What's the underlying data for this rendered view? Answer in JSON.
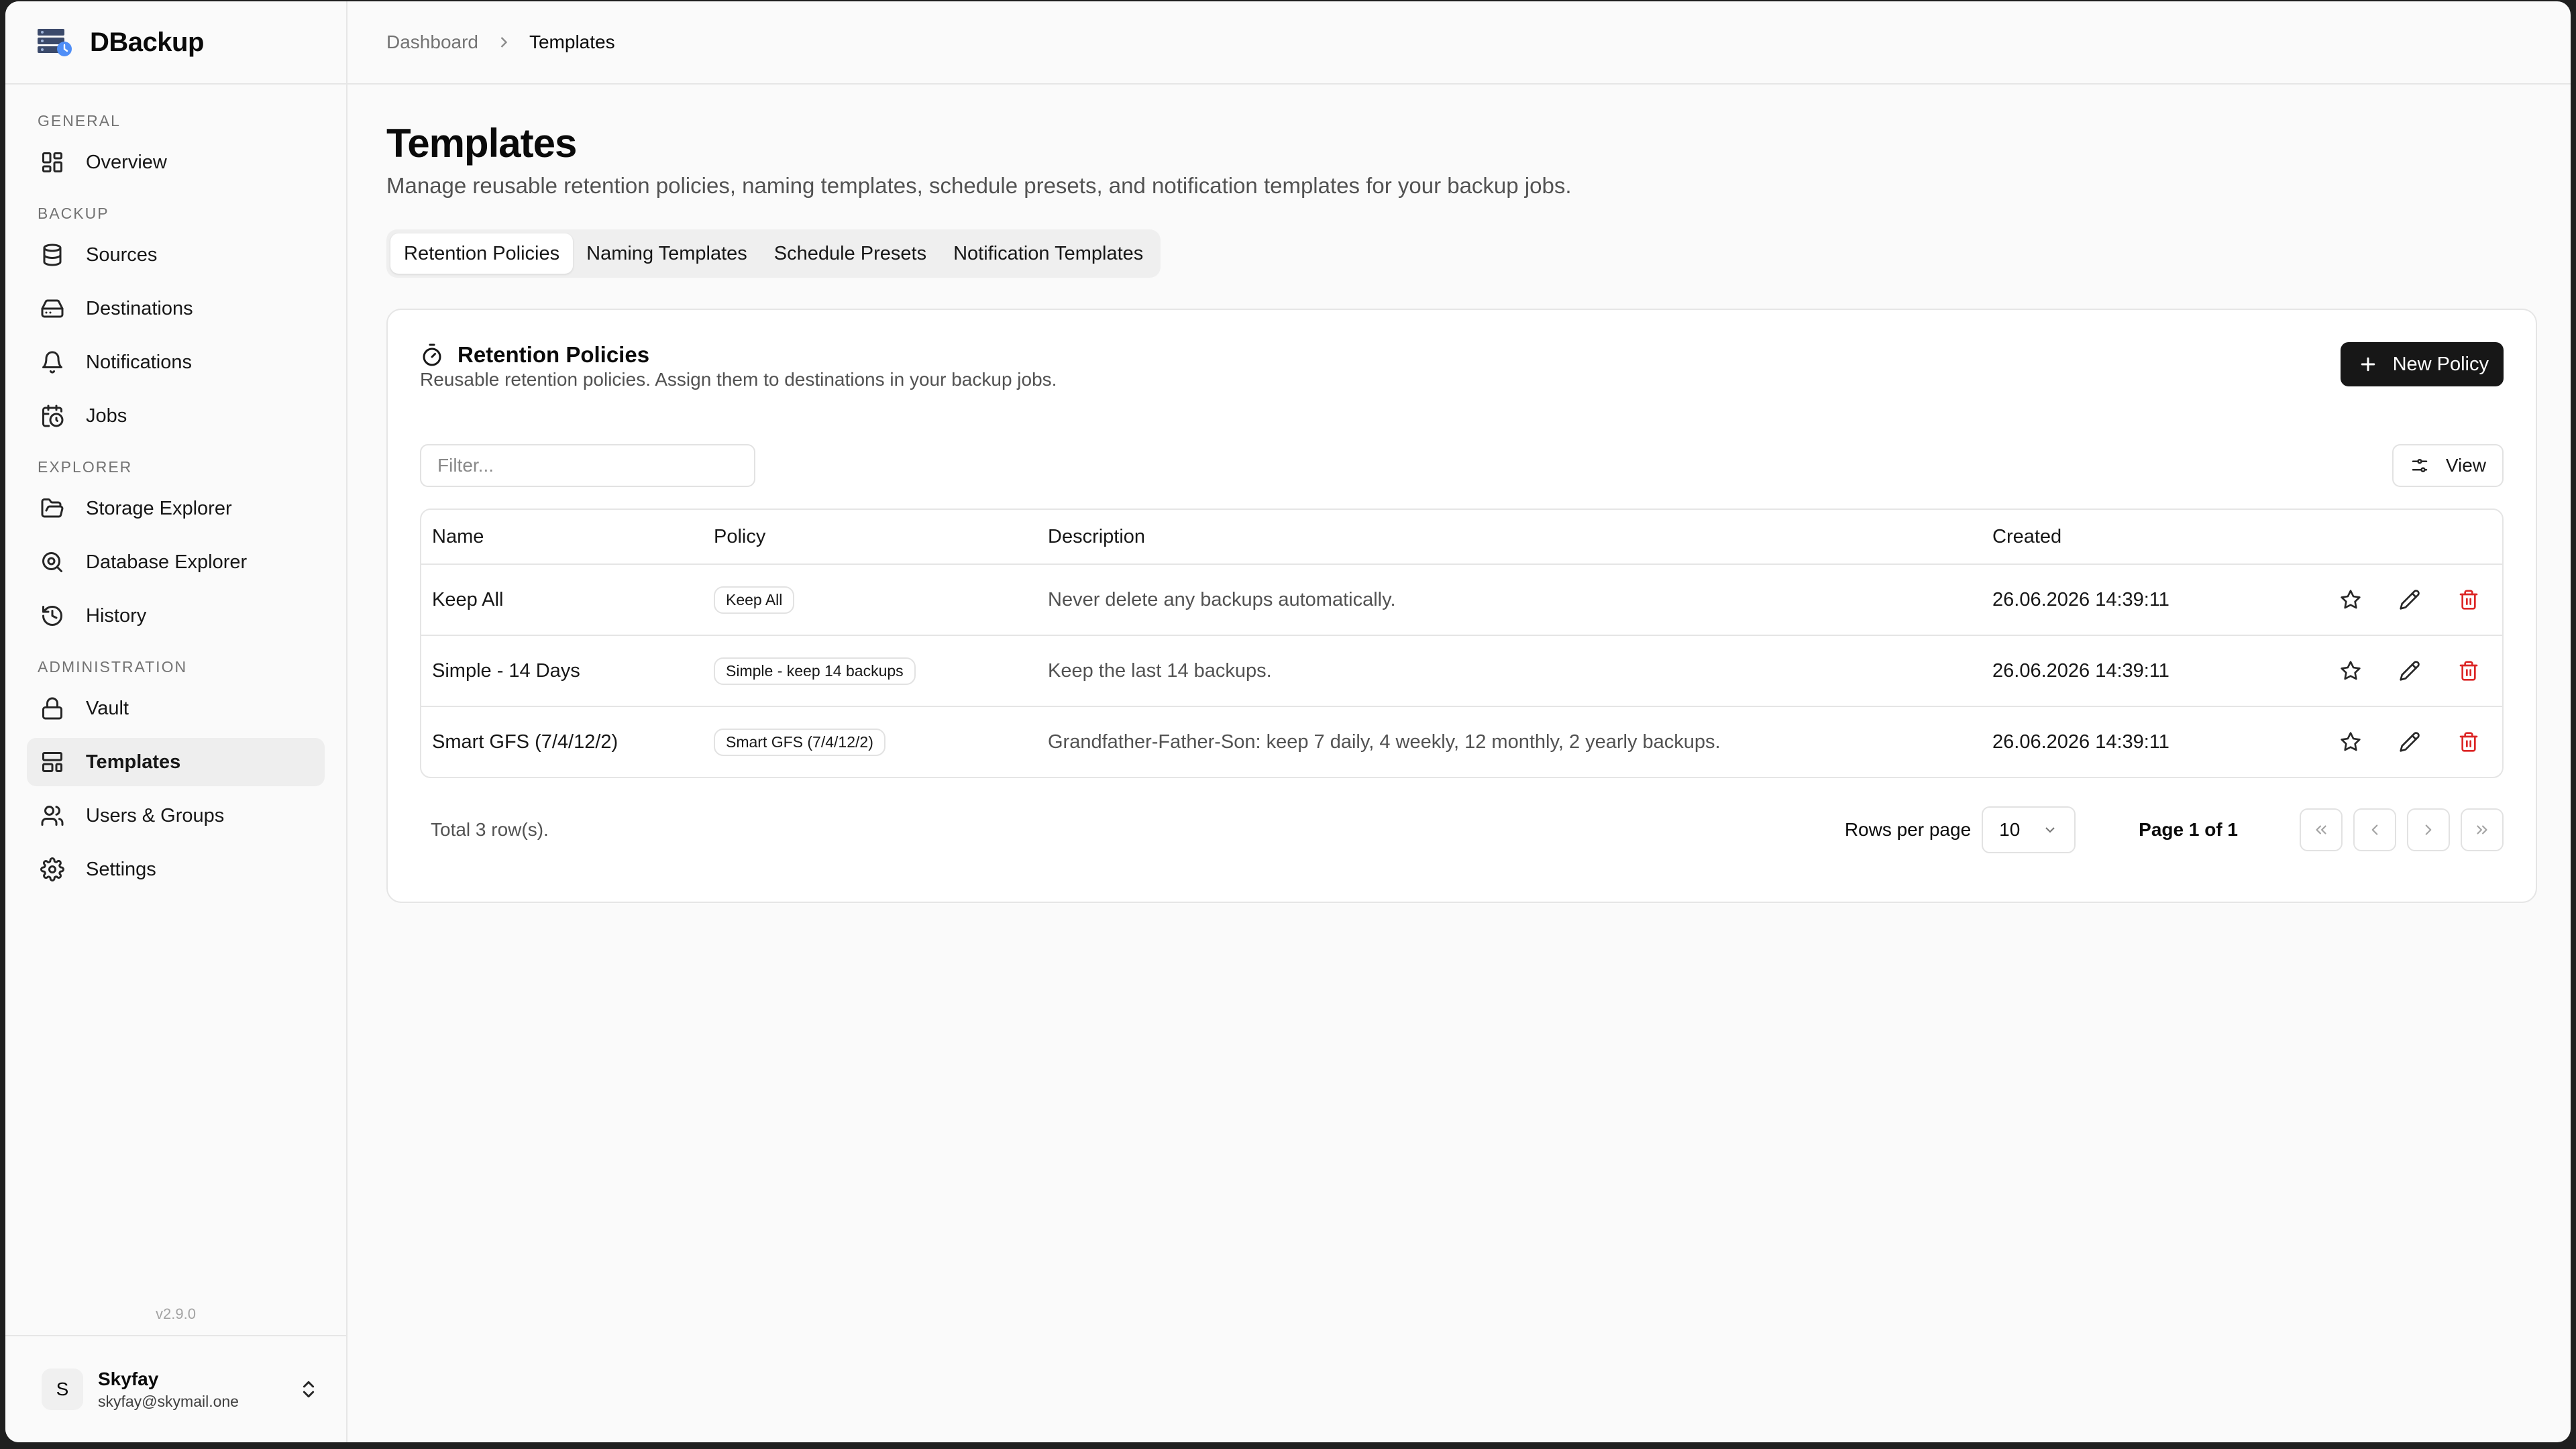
{
  "app": {
    "name": "DBackup",
    "version": "v2.9.0"
  },
  "sidebar": {
    "groups": [
      {
        "label": "GENERAL",
        "items": [
          {
            "label": "Overview",
            "icon": "grid-icon"
          }
        ]
      },
      {
        "label": "BACKUP",
        "items": [
          {
            "label": "Sources",
            "icon": "database-icon"
          },
          {
            "label": "Destinations",
            "icon": "hard-drive-icon"
          },
          {
            "label": "Notifications",
            "icon": "bell-icon"
          },
          {
            "label": "Jobs",
            "icon": "calendar-clock-icon"
          }
        ]
      },
      {
        "label": "EXPLORER",
        "items": [
          {
            "label": "Storage Explorer",
            "icon": "folder-open-icon"
          },
          {
            "label": "Database Explorer",
            "icon": "search-zoom-icon"
          },
          {
            "label": "History",
            "icon": "history-icon"
          }
        ]
      },
      {
        "label": "ADMINISTRATION",
        "items": [
          {
            "label": "Vault",
            "icon": "lock-icon"
          },
          {
            "label": "Templates",
            "icon": "layout-template-icon",
            "active": true
          },
          {
            "label": "Users & Groups",
            "icon": "users-icon"
          },
          {
            "label": "Settings",
            "icon": "gear-icon"
          }
        ]
      }
    ]
  },
  "user": {
    "initial": "S",
    "name": "Skyfay",
    "email": "skyfay@skymail.one"
  },
  "breadcrumb": {
    "parent": "Dashboard",
    "current": "Templates"
  },
  "page": {
    "title": "Templates",
    "description": "Manage reusable retention policies, naming templates, schedule presets, and notification templates for your backup jobs."
  },
  "tabs": [
    "Retention Policies",
    "Naming Templates",
    "Schedule Presets",
    "Notification Templates"
  ],
  "active_tab": "Retention Policies",
  "card": {
    "title": "Retention Policies",
    "description": "Reusable retention policies. Assign them to destinations in your backup jobs.",
    "new_button": "New Policy",
    "filter_placeholder": "Filter...",
    "view_button": "View"
  },
  "table": {
    "columns": [
      "Name",
      "Policy",
      "Description",
      "Created"
    ],
    "rows": [
      {
        "name": "Keep All",
        "policy": "Keep All",
        "description": "Never delete any backups automatically.",
        "created": "26.06.2026 14:39:11"
      },
      {
        "name": "Simple - 14 Days",
        "policy": "Simple - keep 14 backups",
        "description": "Keep the last 14 backups.",
        "created": "26.06.2026 14:39:11"
      },
      {
        "name": "Smart GFS (7/4/12/2)",
        "policy": "Smart GFS (7/4/12/2)",
        "description": "Grandfather-Father-Son: keep 7 daily, 4 weekly, 12 monthly, 2 yearly backups.",
        "created": "26.06.2026 14:39:11"
      }
    ]
  },
  "pagination": {
    "total_text": "Total 3 row(s).",
    "rows_per_page_label": "Rows per page",
    "rows_per_page_value": "10",
    "page_text": "Page 1 of 1"
  },
  "colors": {
    "primary": "#171717",
    "danger": "#dc2626",
    "muted": "#737373",
    "background": "#fafafa"
  }
}
